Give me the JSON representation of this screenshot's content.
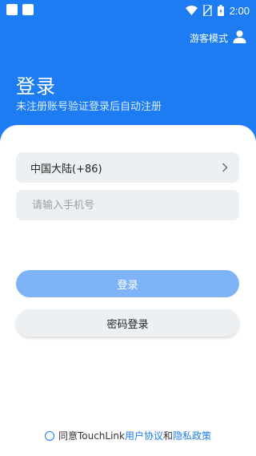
{
  "status": {
    "time": "2:00"
  },
  "guest": {
    "label": "游客模式"
  },
  "header": {
    "title": "登录",
    "subtitle": "未注册账号验证登录后自动注册"
  },
  "form": {
    "region_label": "中国大陆(+86)",
    "phone_placeholder": "请输入手机号",
    "phone_value": ""
  },
  "buttons": {
    "login": "登录",
    "password_login": "密码登录"
  },
  "agreement": {
    "prefix": "同意TouchLink",
    "user_agreement": "用户协议",
    "and": "和",
    "privacy_policy": "隐私政策"
  },
  "colors": {
    "primary": "#1d7cf2",
    "login_button": "#7eb4f7",
    "field_bg": "#edf0f3"
  },
  "icons": [
    "wifi-icon",
    "no-sim-icon",
    "battery-icon",
    "user-icon",
    "chevron-right-icon",
    "radio-unchecked-icon"
  ]
}
